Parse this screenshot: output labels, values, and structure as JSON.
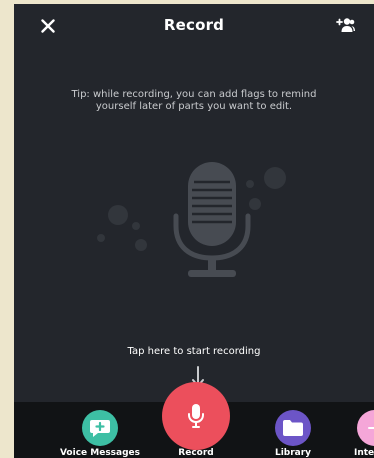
{
  "header": {
    "title": "Record",
    "close_icon": "close-icon",
    "invite_icon": "add-person-icon"
  },
  "tip": {
    "text": "Tip: while recording, you can add flags to remind yourself later of parts you want to edit."
  },
  "hint": {
    "text": "Tap here to start recording"
  },
  "bottom_nav": {
    "items": [
      {
        "label": "Voice Messages",
        "icon": "chat-plus-icon",
        "color": "#3dbfa4"
      },
      {
        "label": "Record",
        "icon": "mic-icon",
        "color": "#ec4f5c"
      },
      {
        "label": "Library",
        "icon": "folder-icon",
        "color": "#6c55c7"
      },
      {
        "label": "Inte",
        "icon": "plus-icon",
        "color": "#f5a6d8"
      }
    ]
  },
  "colors": {
    "background": "#23262c",
    "nav_background": "#111315",
    "mic_graphic": "#474b52"
  }
}
